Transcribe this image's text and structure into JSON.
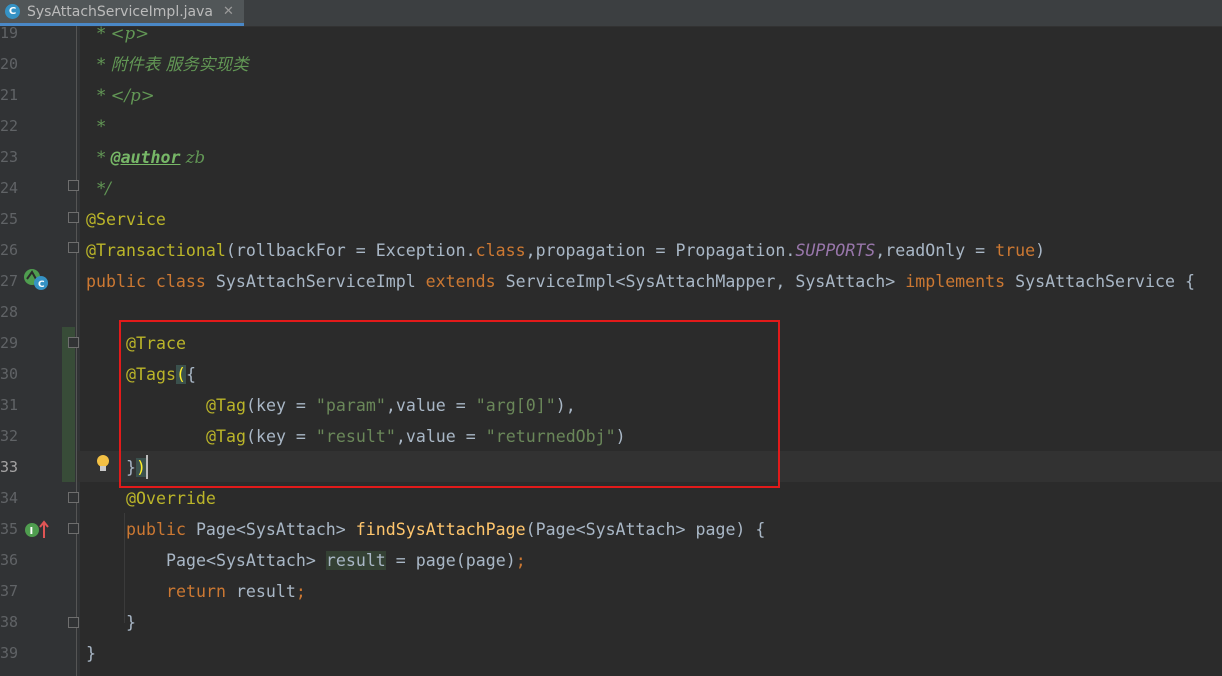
{
  "tab": {
    "icon_letter": "C",
    "filename": "SysAttachServiceImpl.java",
    "close_glyph": "✕"
  },
  "lines": [
    {
      "num": "19",
      "text": "* <p>"
    },
    {
      "num": "20",
      "text": "* 附件表 服务实现类"
    },
    {
      "num": "21",
      "text": "* </p>"
    },
    {
      "num": "22",
      "text": "*"
    },
    {
      "num": "23",
      "text": "* @author zb"
    },
    {
      "num": "24",
      "text": "*/"
    },
    {
      "num": "25",
      "text": "@Service"
    },
    {
      "num": "26",
      "text": "@Transactional(rollbackFor = Exception.class,propagation = Propagation.SUPPORTS,readOnly = true)"
    },
    {
      "num": "27",
      "text": "public class SysAttachServiceImpl extends ServiceImpl<SysAttachMapper, SysAttach> implements SysAttachService {"
    },
    {
      "num": "28",
      "text": ""
    },
    {
      "num": "29",
      "text": "@Trace"
    },
    {
      "num": "30",
      "text": "@Tags({"
    },
    {
      "num": "31",
      "text": "@Tag(key = \"param\",value = \"arg[0]\"),"
    },
    {
      "num": "32",
      "text": "@Tag(key = \"result\",value = \"returnedObj\")"
    },
    {
      "num": "33",
      "text": "})"
    },
    {
      "num": "34",
      "text": "@Override"
    },
    {
      "num": "35",
      "text": "public Page<SysAttach> findSysAttachPage(Page<SysAttach> page) {"
    },
    {
      "num": "36",
      "text": "Page<SysAttach> result = page(page);"
    },
    {
      "num": "37",
      "text": "return result;"
    },
    {
      "num": "38",
      "text": "}"
    },
    {
      "num": "39",
      "text": "}"
    }
  ],
  "tokens": {
    "l19": [
      "* <p>"
    ],
    "l20": [
      "* 附件表 服务实现类"
    ],
    "l21": [
      "* </p>"
    ],
    "l22": [
      "*"
    ],
    "l23": [
      "* ",
      "@author",
      " zb"
    ],
    "l24": [
      "*/"
    ],
    "l25": [
      "@Service"
    ],
    "l26": [
      "@Transactional",
      "(rollbackFor = Exception.",
      "class",
      ",propagation = Propagation.",
      "SUPPORTS",
      ",readOnly = ",
      "true",
      ")"
    ],
    "l27": [
      "public class ",
      "SysAttachServiceImpl ",
      "extends ",
      "ServiceImpl<SysAttachMapper, SysAttach> ",
      "implements ",
      "SysAttachService {"
    ],
    "l29": [
      "@Trace"
    ],
    "l30": [
      "@Tags",
      "(",
      "{"
    ],
    "l31": [
      "@Tag",
      "(key = ",
      "\"param\"",
      ",value = ",
      "\"arg[0]\"",
      "),"
    ],
    "l32": [
      "@Tag",
      "(key = ",
      "\"result\"",
      ",value = ",
      "\"returnedObj\"",
      ")"
    ],
    "l33": [
      "}",
      ")"
    ],
    "l34": [
      "@Override"
    ],
    "l35": [
      "public ",
      "Page<SysAttach> ",
      "findSysAttachPage",
      "(Page<SysAttach> page) {"
    ],
    "l36": [
      "Page<SysAttach> ",
      "result",
      " = page(page)",
      ";"
    ],
    "l37": [
      "return ",
      "result",
      ";"
    ],
    "l38": [
      "}"
    ],
    "l39": [
      "}"
    ]
  },
  "colors": {
    "background": "#2b2b2b",
    "keyword": "#cc7832",
    "annotation": "#bbb529",
    "string": "#6a8759",
    "comment": "#629755",
    "highlight_box": "#e21a1a"
  },
  "icons": [
    "class-run-icon",
    "implements-method-icon",
    "intention-bulb-icon",
    "fold-icon"
  ]
}
